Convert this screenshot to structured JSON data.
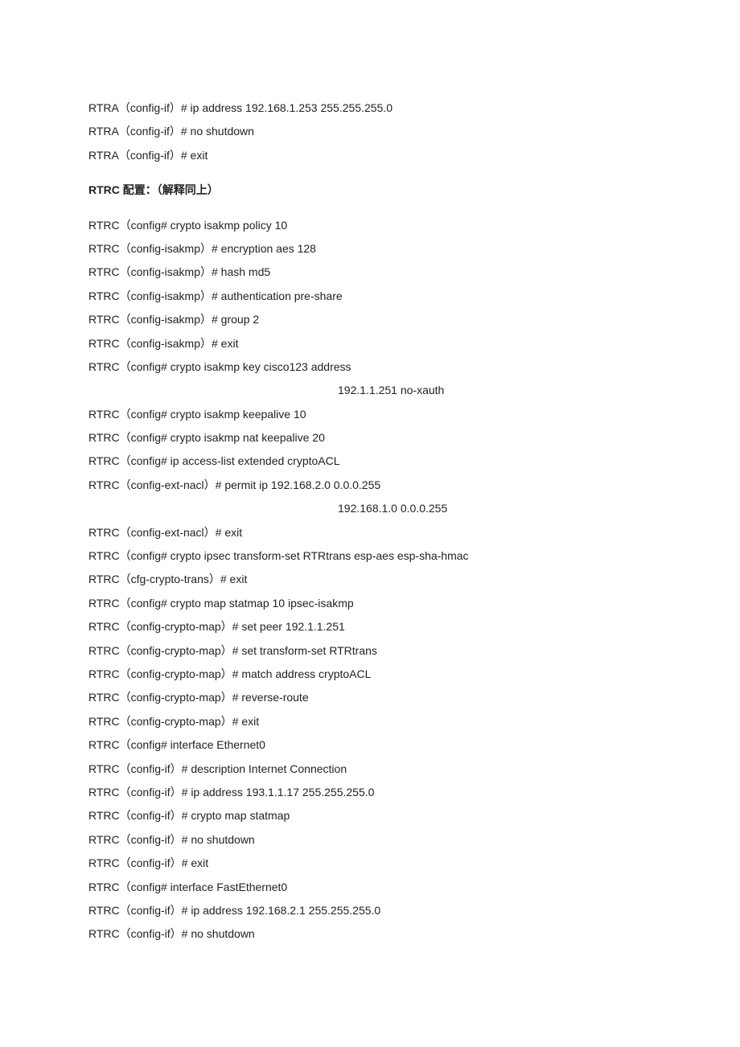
{
  "lines": [
    {
      "text": "RTRA（config-if）# ip address 192.168.1.253 255.255.255.0"
    },
    {
      "text": "RTRA（config-if）# no shutdown"
    },
    {
      "text": "RTRA（config-if）# exit"
    },
    {
      "gap": true
    },
    {
      "text": "RTRC 配置：（解释同上）",
      "bold": true
    },
    {
      "gap": true
    },
    {
      "text": "RTRC（config# crypto isakmp policy 10"
    },
    {
      "text": "RTRC（config-isakmp）# encryption aes 128"
    },
    {
      "text": "RTRC（config-isakmp）# hash md5"
    },
    {
      "text": "RTRC（config-isakmp）# authentication pre-share"
    },
    {
      "text": "RTRC（config-isakmp）# group 2"
    },
    {
      "text": "RTRC（config-isakmp）# exit"
    },
    {
      "text": "RTRC（config# crypto isakmp key cisco123 address"
    },
    {
      "text": "192.1.1.251 no-xauth",
      "indent": true
    },
    {
      "text": "RTRC（config# crypto isakmp keepalive 10"
    },
    {
      "text": "RTRC（config# crypto isakmp nat keepalive 20"
    },
    {
      "text": "RTRC（config# ip access-list extended cryptoACL"
    },
    {
      "text": "RTRC（config-ext-nacl）# permit ip 192.168.2.0 0.0.0.255"
    },
    {
      "text": "192.168.1.0 0.0.0.255",
      "indent": true
    },
    {
      "text": "RTRC（config-ext-nacl）# exit"
    },
    {
      "text": "RTRC（config# crypto ipsec transform-set RTRtrans esp-aes esp-sha-hmac"
    },
    {
      "text": "RTRC（cfg-crypto-trans）# exit"
    },
    {
      "text": "RTRC（config# crypto map statmap 10 ipsec-isakmp"
    },
    {
      "text": "RTRC（config-crypto-map）# set peer 192.1.1.251"
    },
    {
      "text": "RTRC（config-crypto-map）# set transform-set RTRtrans"
    },
    {
      "text": "RTRC（config-crypto-map）# match address cryptoACL"
    },
    {
      "text": "RTRC（config-crypto-map）# reverse-route"
    },
    {
      "text": "RTRC（config-crypto-map）# exit"
    },
    {
      "text": "RTRC（config# interface Ethernet0"
    },
    {
      "text": "RTRC（config-if）# description Internet Connection"
    },
    {
      "text": "RTRC（config-if）# ip address 193.1.1.17 255.255.255.0"
    },
    {
      "text": "RTRC（config-if）# crypto map statmap"
    },
    {
      "text": "RTRC（config-if）# no shutdown"
    },
    {
      "text": "RTRC（config-if）# exit"
    },
    {
      "text": "RTRC（config# interface FastEthernet0"
    },
    {
      "text": "RTRC（config-if）# ip address 192.168.2.1 255.255.255.0"
    },
    {
      "text": "RTRC（config-if）# no shutdown"
    }
  ]
}
